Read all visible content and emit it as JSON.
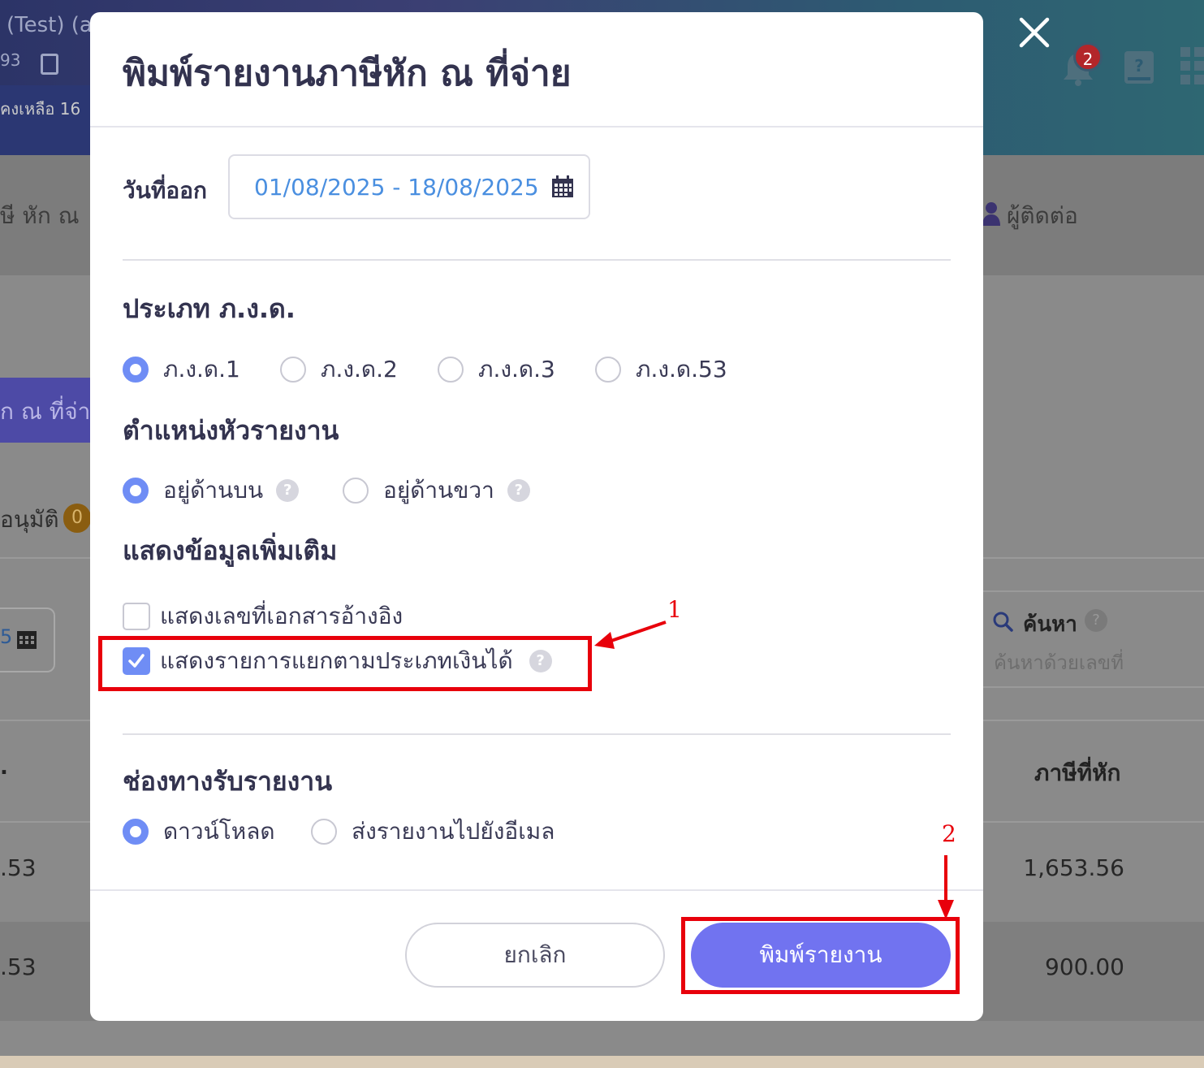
{
  "background": {
    "company_name": "(Test) (a",
    "tax_id_fragment": "93",
    "remaining_text": "คงเหลือ 16",
    "notification_count": "2",
    "tab_left_text": "ษี หัก ณ",
    "contact_tab": "ผู้ติดต่อ",
    "purple_button_text": "ัก ณ ที่จ่า",
    "approve_text": "อนุมัติ",
    "approve_count": "0",
    "date_fragment": "5",
    "search_label": "ค้นหา",
    "search_placeholder": "ค้นหาด้วยเลขที่",
    "table_header_left": ".",
    "table_header_tax": "ภาษีที่หัก",
    "rows": [
      {
        "left": ".53",
        "tax": "1,653.56"
      },
      {
        "left": ".53",
        "tax": "900.00"
      }
    ]
  },
  "modal": {
    "title": "พิมพ์รายงานภาษีหัก ณ ที่จ่าย",
    "issue_date_label": "วันที่ออก",
    "date_range": "01/08/2025 - 18/08/2025",
    "pnd_type_label": "ประเภท ภ.ง.ด.",
    "pnd_options": [
      {
        "label": "ภ.ง.ด.1",
        "selected": true
      },
      {
        "label": "ภ.ง.ด.2",
        "selected": false
      },
      {
        "label": "ภ.ง.ด.3",
        "selected": false
      },
      {
        "label": "ภ.ง.ด.53",
        "selected": false
      }
    ],
    "header_position_label": "ตำแหน่งหัวรายงาน",
    "header_position_options": [
      {
        "label": "อยู่ด้านบน",
        "selected": true
      },
      {
        "label": "อยู่ด้านขวา",
        "selected": false
      }
    ],
    "extra_info_label": "แสดงข้อมูลเพิ่มเติม",
    "extra_options": [
      {
        "label": "แสดงเลขที่เอกสารอ้างอิง",
        "checked": false
      },
      {
        "label": "แสดงรายการแยกตามประเภทเงินได้",
        "checked": true
      }
    ],
    "channel_label": "ช่องทางรับรายงาน",
    "channel_options": [
      {
        "label": "ดาวน์โหลด",
        "selected": true
      },
      {
        "label": "ส่งรายงานไปยังอีเมล",
        "selected": false
      }
    ],
    "cancel_button": "ยกเลิก",
    "print_button": "พิมพ์รายงาน",
    "help_symbol": "?"
  },
  "annotations": {
    "step1": "1",
    "step2": "2",
    "color": "#e8000b"
  },
  "colors": {
    "accent": "#6f8df5",
    "primary_button": "#7173f0",
    "date_text": "#4a8fe0",
    "title_text": "#33334f"
  }
}
